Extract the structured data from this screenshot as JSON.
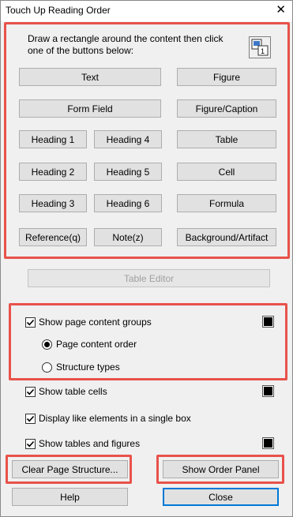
{
  "window": {
    "title": "Touch Up Reading Order"
  },
  "instructions": "Draw a rectangle around the content then click one of the buttons below:",
  "tag_buttons": {
    "text": "Text",
    "figure": "Figure",
    "form_field": "Form Field",
    "figure_caption": "Figure/Caption",
    "heading1": "Heading 1",
    "heading4": "Heading 4",
    "table": "Table",
    "heading2": "Heading 2",
    "heading5": "Heading 5",
    "cell": "Cell",
    "heading3": "Heading 3",
    "heading6": "Heading 6",
    "formula": "Formula",
    "reference": "Reference(q)",
    "note": "Note(z)",
    "background_artifact": "Background/Artifact"
  },
  "table_editor": "Table Editor",
  "options": {
    "show_content_groups": {
      "label": "Show page content groups",
      "checked": true
    },
    "page_content_order": {
      "label": "Page content order",
      "selected": true
    },
    "structure_types": {
      "label": "Structure types",
      "selected": false
    },
    "show_table_cells": {
      "label": "Show table cells",
      "checked": true
    },
    "display_like_elements": {
      "label": "Display like elements in a single box",
      "checked": true
    },
    "show_tables_figures": {
      "label": "Show tables and figures",
      "checked": true
    }
  },
  "colors": {
    "highlight": "#e8524a",
    "swatch": "#000000",
    "focus": "#0078d7"
  },
  "bottom": {
    "clear": "Clear Page Structure...",
    "show_order": "Show Order Panel",
    "help": "Help",
    "close": "Close"
  }
}
